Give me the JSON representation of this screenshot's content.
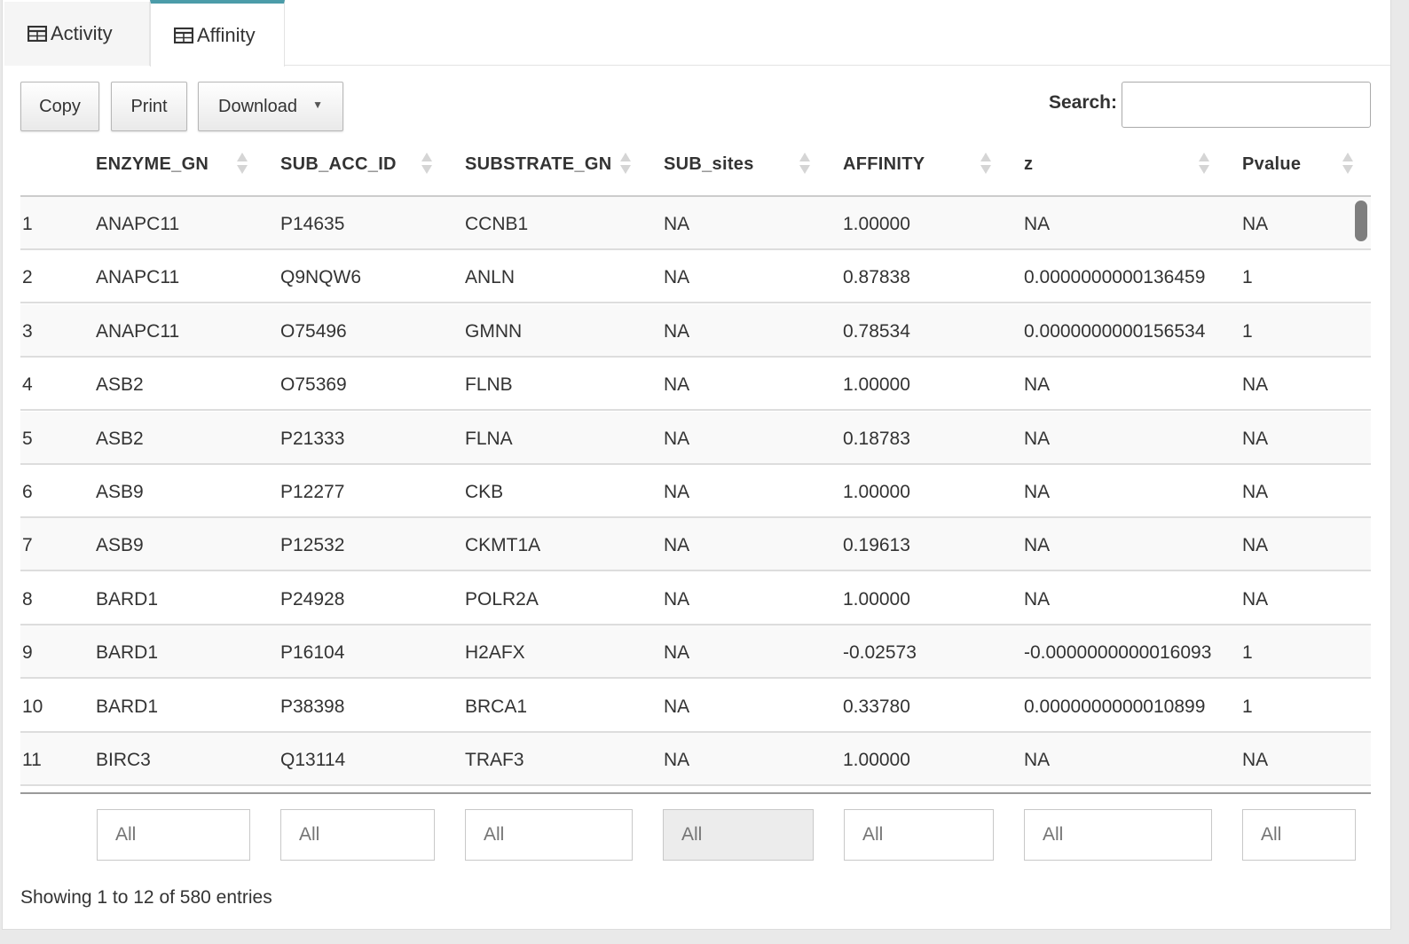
{
  "tabs": [
    {
      "label": "Activity",
      "icon": "table-icon",
      "active": false
    },
    {
      "label": "Affinity",
      "icon": "table-icon",
      "active": true
    }
  ],
  "toolbar": {
    "copy_label": "Copy",
    "print_label": "Print",
    "download_label": "Download",
    "search_label": "Search:",
    "search_value": ""
  },
  "table": {
    "columns": [
      "",
      "ENZYME_GN",
      "SUB_ACC_ID",
      "SUBSTRATE_GN",
      "SUB_sites",
      "AFFINITY",
      "z",
      "Pvalue"
    ],
    "rows": [
      [
        "1",
        "ANAPC11",
        "P14635",
        "CCNB1",
        "NA",
        "1.00000",
        "NA",
        "NA"
      ],
      [
        "2",
        "ANAPC11",
        "Q9NQW6",
        "ANLN",
        "NA",
        "0.87838",
        "0.0000000000136459",
        "1"
      ],
      [
        "3",
        "ANAPC11",
        "O75496",
        "GMNN",
        "NA",
        "0.78534",
        "0.0000000000156534",
        "1"
      ],
      [
        "4",
        "ASB2",
        "O75369",
        "FLNB",
        "NA",
        "1.00000",
        "NA",
        "NA"
      ],
      [
        "5",
        "ASB2",
        "P21333",
        "FLNA",
        "NA",
        "0.18783",
        "NA",
        "NA"
      ],
      [
        "6",
        "ASB9",
        "P12277",
        "CKB",
        "NA",
        "1.00000",
        "NA",
        "NA"
      ],
      [
        "7",
        "ASB9",
        "P12532",
        "CKMT1A",
        "NA",
        "0.19613",
        "NA",
        "NA"
      ],
      [
        "8",
        "BARD1",
        "P24928",
        "POLR2A",
        "NA",
        "1.00000",
        "NA",
        "NA"
      ],
      [
        "9",
        "BARD1",
        "P16104",
        "H2AFX",
        "NA",
        "-0.02573",
        "-0.0000000000016093",
        "1"
      ],
      [
        "10",
        "BARD1",
        "P38398",
        "BRCA1",
        "NA",
        "0.33780",
        "0.0000000000010899",
        "1"
      ],
      [
        "11",
        "BIRC3",
        "Q13114",
        "TRAF3",
        "NA",
        "1.00000",
        "NA",
        "NA"
      ]
    ],
    "filters": [
      "All",
      "All",
      "All",
      "All",
      "All",
      "All",
      "All"
    ],
    "info": "Showing 1 to 12 of 580 entries"
  },
  "colors": {
    "accent": "#4b9ca9",
    "row_stripe": "#f9f9f9"
  }
}
